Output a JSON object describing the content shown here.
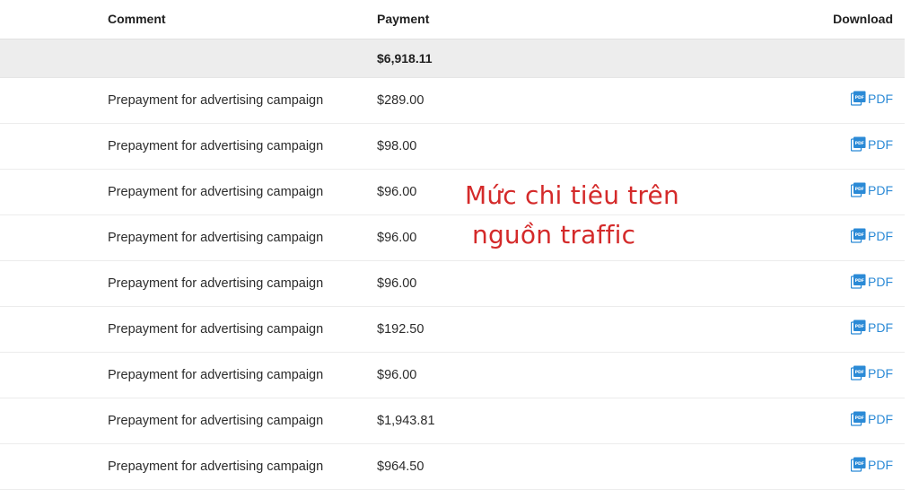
{
  "table": {
    "headers": {
      "comment": "Comment",
      "payment": "Payment",
      "download": "Download"
    },
    "total": "$6,918.11",
    "rows": [
      {
        "comment": "Prepayment for advertising campaign",
        "payment": "$289.00",
        "download": "PDF"
      },
      {
        "comment": "Prepayment for advertising campaign",
        "payment": "$98.00",
        "download": "PDF"
      },
      {
        "comment": "Prepayment for advertising campaign",
        "payment": "$96.00",
        "download": "PDF"
      },
      {
        "comment": "Prepayment for advertising campaign",
        "payment": "$96.00",
        "download": "PDF"
      },
      {
        "comment": "Prepayment for advertising campaign",
        "payment": "$96.00",
        "download": "PDF"
      },
      {
        "comment": "Prepayment for advertising campaign",
        "payment": "$192.50",
        "download": "PDF"
      },
      {
        "comment": "Prepayment for advertising campaign",
        "payment": "$96.00",
        "download": "PDF"
      },
      {
        "comment": "Prepayment for advertising campaign",
        "payment": "$1,943.81",
        "download": "PDF"
      },
      {
        "comment": "Prepayment for advertising campaign",
        "payment": "$964.50",
        "download": "PDF"
      }
    ]
  },
  "annotation": {
    "line1": "Mức chi tiêu trên",
    "line2": "nguồn traffic"
  },
  "icons": {
    "download": "pdf-file-icon"
  },
  "colors": {
    "link": "#2b8ad6",
    "annotation": "#d42a2a",
    "total_row_bg": "#ededed"
  }
}
